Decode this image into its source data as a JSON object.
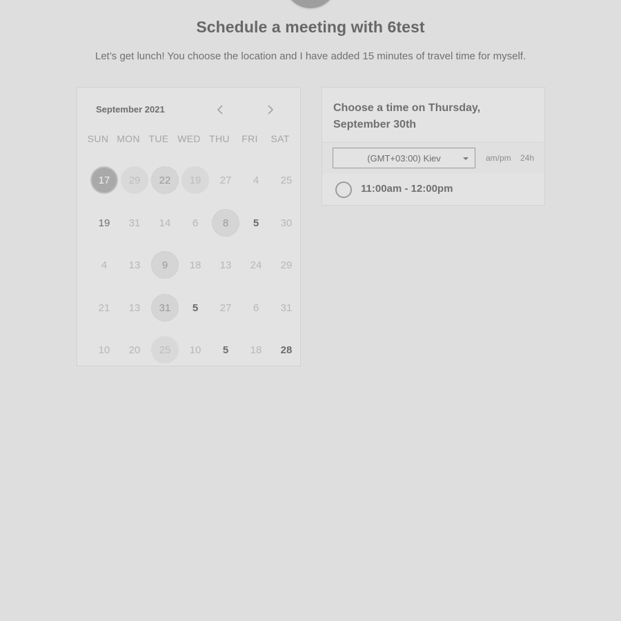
{
  "header": {
    "title": "Schedule a meeting with 6test",
    "subtitle": "Let’s get lunch! You choose the location and I have added 15 minutes of travel time for myself."
  },
  "calendar": {
    "month_label": "September 2021",
    "prev_icon": "chevron-left-icon",
    "next_icon": "chevron-right-icon",
    "weekdays": [
      "SUN",
      "MON",
      "TUE",
      "WED",
      "THU",
      "FRI",
      "SAT"
    ],
    "weeks": [
      [
        "17",
        "29",
        "22",
        "19",
        "27",
        "4",
        "25"
      ],
      [
        "19",
        "31",
        "14",
        "6",
        "8",
        "5",
        "30"
      ],
      [
        "4",
        "13",
        "9",
        "18",
        "13",
        "24",
        "29"
      ],
      [
        "21",
        "13",
        "31",
        "5",
        "27",
        "6",
        "31"
      ],
      [
        "10",
        "20",
        "25",
        "10",
        "5",
        "18",
        "28"
      ]
    ]
  },
  "time_panel": {
    "heading": "Choose a time on Thursday, September 30th",
    "timezone": "(GMT+03:00) Kiev",
    "format_ampm": "am/pm",
    "format_24h": "24h",
    "slots": [
      "11:00am - 12:00pm"
    ]
  },
  "colors": {
    "background": "#dedede",
    "card": "#e3e3e3",
    "selected_day": "#a9a9a9"
  }
}
